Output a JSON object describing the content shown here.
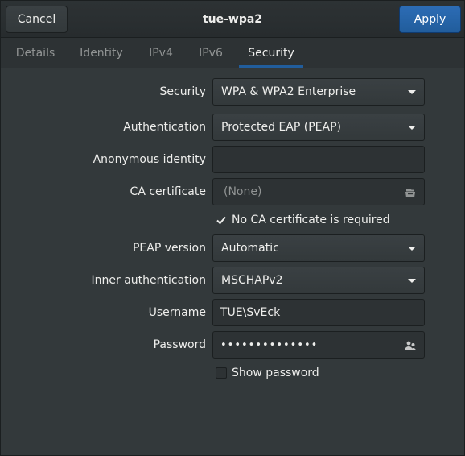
{
  "window": {
    "title": "tue-wpa2"
  },
  "header": {
    "cancel_label": "Cancel",
    "apply_label": "Apply"
  },
  "tabs": [
    {
      "label": "Details",
      "active": false
    },
    {
      "label": "Identity",
      "active": false
    },
    {
      "label": "IPv4",
      "active": false
    },
    {
      "label": "IPv6",
      "active": false
    },
    {
      "label": "Security",
      "active": true
    }
  ],
  "security": {
    "security_label": "Security",
    "security_value": "WPA & WPA2 Enterprise",
    "authentication_label": "Authentication",
    "authentication_value": "Protected EAP (PEAP)",
    "anonymous_identity_label": "Anonymous identity",
    "anonymous_identity_value": "",
    "ca_certificate_label": "CA certificate",
    "ca_certificate_value": "(None)",
    "no_ca_required_label": "No CA certificate is required",
    "no_ca_required_checked": true,
    "peap_version_label": "PEAP version",
    "peap_version_value": "Automatic",
    "inner_auth_label": "Inner authentication",
    "inner_auth_value": "MSCHAPv2",
    "username_label": "Username",
    "username_value": "TUE\\SvEck",
    "password_label": "Password",
    "password_value": "••••••••••••••",
    "show_password_label": "Show password",
    "show_password_checked": false
  },
  "icons": {
    "file_chooser": "document-open-icon",
    "password_storage": "users-icon",
    "dropdown": "pan-down-icon",
    "check": "checkmark-icon"
  },
  "colors": {
    "background": "#33393b",
    "accent": "#215d9c",
    "text": "#eeeeec",
    "dim_text": "#919494"
  }
}
